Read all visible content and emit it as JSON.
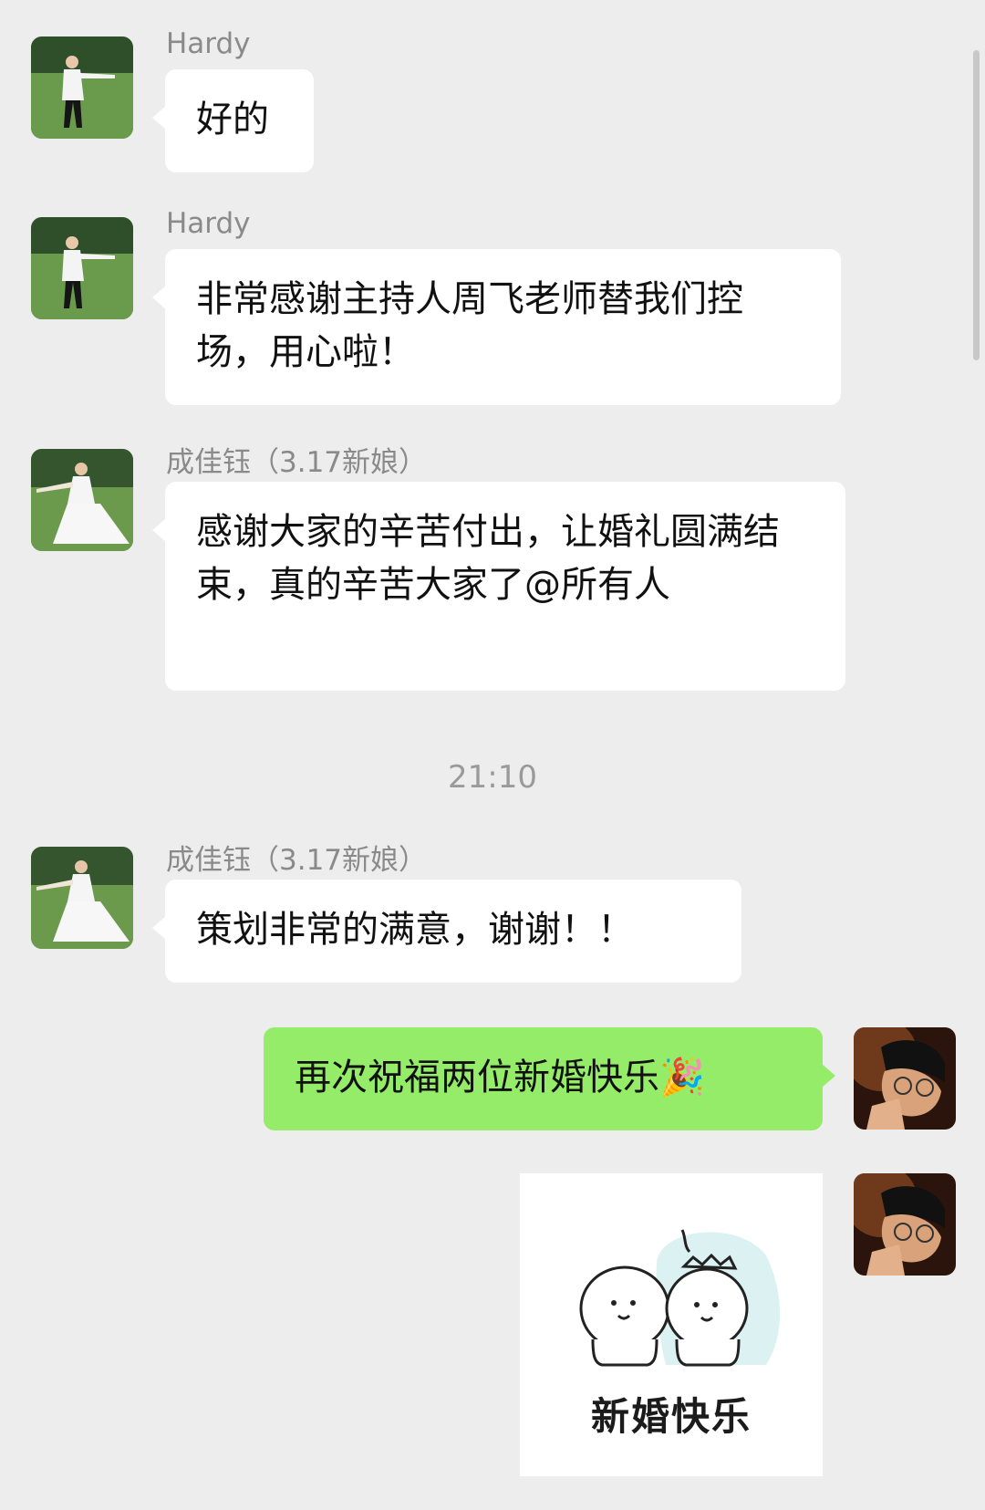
{
  "messages": [
    {
      "sender": "Hardy",
      "text": "好的"
    },
    {
      "sender": "Hardy",
      "text": "非常感谢主持人周飞老师替我们控场，用心啦！"
    },
    {
      "sender": "成佳钰（3.17新娘）",
      "text": "感谢大家的辛苦付出，让婚礼圆满结束，真的辛苦大家了@所有人"
    },
    {
      "sender": "成佳钰（3.17新娘）",
      "text": "策划非常的满意，谢谢！！"
    },
    {
      "sender": "self",
      "text": "再次祝福两位新婚快乐",
      "emoji": "🎉"
    },
    {
      "sender": "self",
      "sticker_caption": "新婚快乐"
    }
  ],
  "timestamp": "21:10",
  "colors": {
    "background": "#ededed",
    "incoming_bubble": "#ffffff",
    "outgoing_bubble": "#95ec69"
  },
  "icons": {
    "groom_avatar": "groom-photo-avatar",
    "bride_avatar": "bride-photo-avatar",
    "self_avatar": "self-photo-avatar",
    "sticker": "wedding-couple-sticker"
  }
}
